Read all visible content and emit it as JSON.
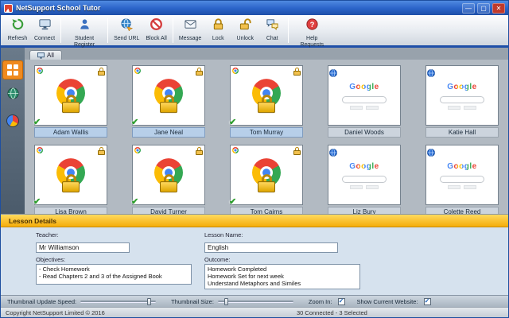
{
  "window": {
    "title": "NetSupport School Tutor"
  },
  "toolbar": {
    "items": [
      {
        "label": "Refresh",
        "icon": "refresh-icon"
      },
      {
        "label": "Connect",
        "icon": "connect-icon"
      },
      {
        "label": "Student Register",
        "icon": "student-register-icon"
      },
      {
        "label": "Send URL",
        "icon": "send-url-icon"
      },
      {
        "label": "Block All",
        "icon": "block-all-icon"
      },
      {
        "label": "Message",
        "icon": "message-icon"
      },
      {
        "label": "Lock",
        "icon": "lock-icon"
      },
      {
        "label": "Unlock",
        "icon": "unlock-icon"
      },
      {
        "label": "Chat",
        "icon": "chat-icon"
      },
      {
        "label": "Help Requests",
        "icon": "help-requests-icon"
      }
    ]
  },
  "tabs": {
    "all_label": "All"
  },
  "students": [
    {
      "name": "Adam Wallis",
      "view": "locked",
      "selected": true
    },
    {
      "name": "Jane Neal",
      "view": "locked",
      "selected": true
    },
    {
      "name": "Tom Murray",
      "view": "locked",
      "selected": true
    },
    {
      "name": "Daniel Woods",
      "view": "web",
      "selected": false
    },
    {
      "name": "Katie Hall",
      "view": "web",
      "selected": false
    },
    {
      "name": "Lisa Brown",
      "view": "locked",
      "selected": false
    },
    {
      "name": "David Turner",
      "view": "locked",
      "selected": false
    },
    {
      "name": "Tom Cairns",
      "view": "locked",
      "selected": false
    },
    {
      "name": "Liz Bury",
      "view": "web",
      "selected": false
    },
    {
      "name": "Colette Reed",
      "view": "web",
      "selected": false
    }
  ],
  "web_page": {
    "logo": "Google"
  },
  "lesson": {
    "header": "Lesson Details",
    "teacher_label": "Teacher:",
    "teacher_value": "Mr Williamson",
    "lesson_name_label": "Lesson Name:",
    "lesson_name_value": "English",
    "objectives_label": "Objectives:",
    "objectives_value": "- Check Homework\n- Read Chapters 2 and 3 of the Assigned Book",
    "outcome_label": "Outcome:",
    "outcome_value": "Homework Completed\nHomework  Set for next week\nUnderstand Metaphors and Similes"
  },
  "controls": {
    "speed_label": "Thumbnail Update Speed:",
    "size_label": "Thumbnail Size:",
    "zoom_label": "Zoom In:",
    "website_label": "Show Current Website:",
    "speed_percent": 88,
    "size_percent": 8,
    "zoom_checked": true,
    "website_checked": true
  },
  "status": {
    "copyright": "Copyright NetSupport Limited © 2016",
    "connection": "30 Connected - 3 Selected"
  },
  "colors": {
    "titlebar_blue": "#2a63c8",
    "accent_orange": "#f08a1e",
    "lesson_gold": "#f5ad0a",
    "lock_gold": "#e6b422",
    "chrome_red": "#ea4335",
    "chrome_yellow": "#fbbc05",
    "chrome_green": "#34a853",
    "chrome_blue": "#4285f4"
  }
}
